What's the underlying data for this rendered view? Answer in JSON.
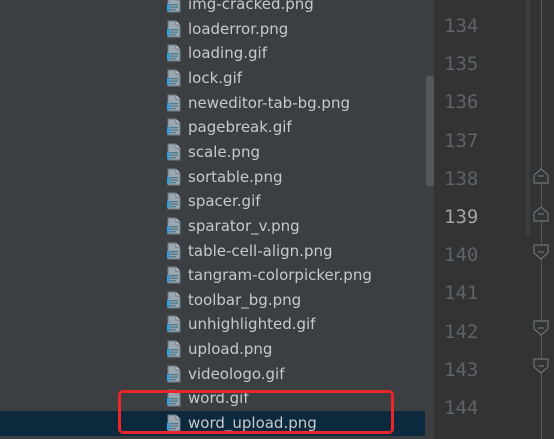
{
  "project_tree": {
    "files": [
      {
        "name": "img-cracked.png",
        "selected": false
      },
      {
        "name": "loaderror.png",
        "selected": false
      },
      {
        "name": "loading.gif",
        "selected": false
      },
      {
        "name": "lock.gif",
        "selected": false
      },
      {
        "name": "neweditor-tab-bg.png",
        "selected": false
      },
      {
        "name": "pagebreak.gif",
        "selected": false
      },
      {
        "name": "scale.png",
        "selected": false
      },
      {
        "name": "sortable.png",
        "selected": false
      },
      {
        "name": "spacer.gif",
        "selected": false
      },
      {
        "name": "sparator_v.png",
        "selected": false
      },
      {
        "name": "table-cell-align.png",
        "selected": false
      },
      {
        "name": "tangram-colorpicker.png",
        "selected": false
      },
      {
        "name": "toolbar_bg.png",
        "selected": false
      },
      {
        "name": "unhighlighted.gif",
        "selected": false
      },
      {
        "name": "upload.png",
        "selected": false
      },
      {
        "name": "videologo.gif",
        "selected": false
      },
      {
        "name": "word.gif",
        "selected": false
      },
      {
        "name": "word_upload.png",
        "selected": true
      }
    ]
  },
  "gutter": {
    "line_numbers": [
      "134",
      "135",
      "136",
      "137",
      "138",
      "139",
      "140",
      "141",
      "142",
      "143",
      "144"
    ],
    "current_line": "139"
  },
  "colors": {
    "panel_bg": "#3c3f41",
    "gutter_bg": "#313335",
    "selection_bg": "#0d293e",
    "annotation_border": "#e8262b"
  },
  "icons": {
    "file": "file-image-icon",
    "fold": "fold-marker-icon"
  }
}
